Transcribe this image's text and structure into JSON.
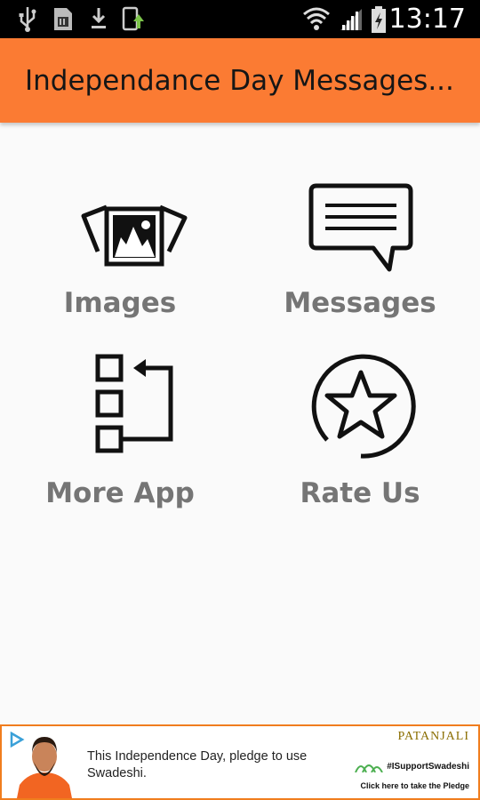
{
  "status_bar": {
    "time": "13:17",
    "icons": [
      "usb-icon",
      "sd-card-icon",
      "download-icon",
      "app-update-icon",
      "wifi-icon",
      "signal-icon",
      "battery-charging-icon"
    ]
  },
  "toolbar": {
    "title": "Independance Day Messages..."
  },
  "menu": {
    "items": [
      {
        "label": "Images",
        "icon": "images-icon"
      },
      {
        "label": "Messages",
        "icon": "message-icon"
      },
      {
        "label": "More App",
        "icon": "more-apps-icon"
      },
      {
        "label": "Rate Us",
        "icon": "star-icon"
      }
    ]
  },
  "ad": {
    "text": "This Independence Day, pledge to use Swadeshi.",
    "brand": "PATANJALI",
    "hashtag": "#ISupportSwadeshi",
    "cta": "Click here to take the Pledge",
    "accent": "#f07d1e"
  },
  "colors": {
    "toolbar": "#fb7b33",
    "label": "#757575",
    "background": "#fafafa"
  }
}
